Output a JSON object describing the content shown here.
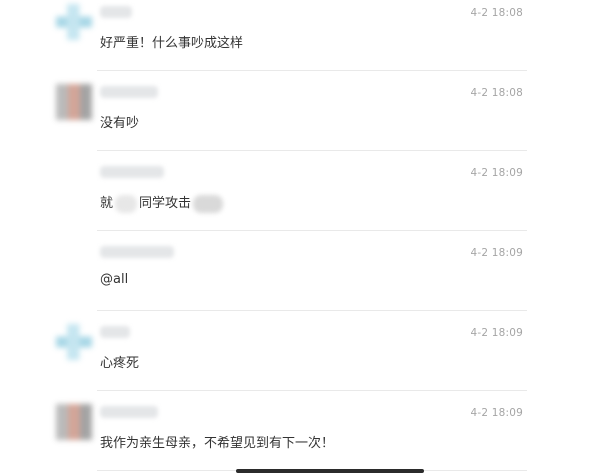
{
  "messages": [
    {
      "time": "4-2 18:08",
      "text": "好严重！什么事吵成这样"
    },
    {
      "time": "4-2 18:08",
      "text": "没有吵"
    },
    {
      "time": "4-2 18:09",
      "text_before": "就",
      "text_mid": "同学攻击",
      "text_after": ""
    },
    {
      "time": "4-2 18:09",
      "text": "@all"
    },
    {
      "time": "4-2 18:09",
      "text": "心疼死"
    },
    {
      "time": "4-2 18:09",
      "text": "我作为亲生母亲，不希望见到有下一次！"
    }
  ],
  "colors": {
    "timestamp": "#a5a5a5",
    "message_text": "#333333",
    "divider": "#e9e9e9",
    "home_indicator": "#2b2b2b"
  }
}
